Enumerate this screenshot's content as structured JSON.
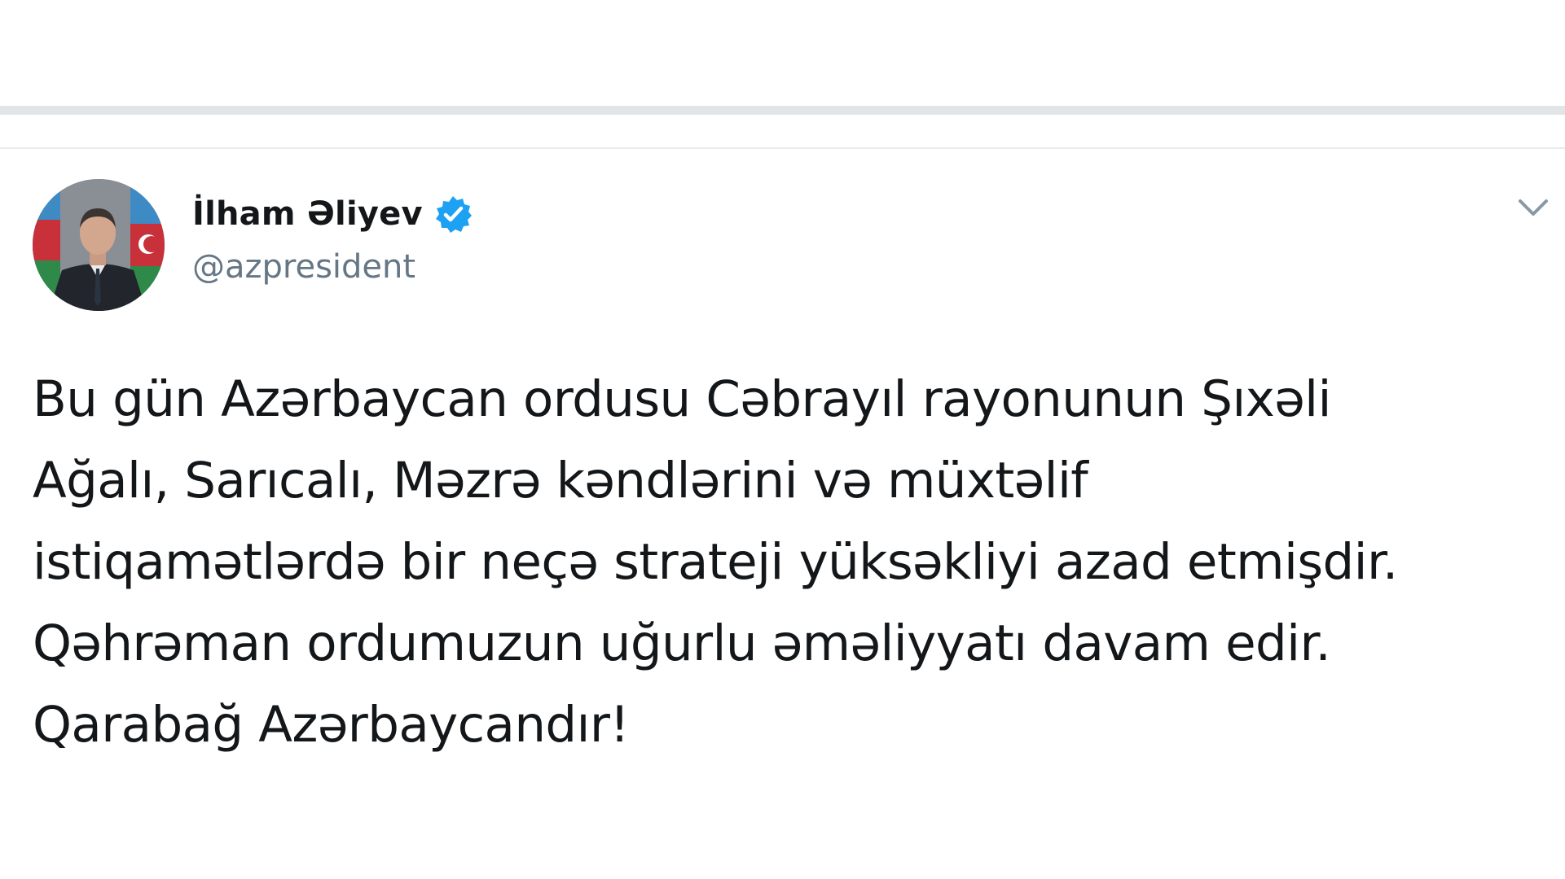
{
  "tweet": {
    "author": {
      "display_name": "İlham Əliyev",
      "handle": "@azpresident",
      "verified": true
    },
    "text_lines": [
      "Bu gün Azərbaycan ordusu Cəbrayıl rayonunun Şıxəli",
      "Ağalı, Sarıcalı, Məzrə kəndlərini və müxtəlif",
      "istiqamətlərdə bir neçə strateji yüksəkliyi azad etmişdir.",
      "Qəhrəman ordumuzun uğurlu əməliyyatı davam edir.",
      "Qarabağ Azərbaycandır!"
    ]
  },
  "icons": {
    "verified": "verified-badge-icon",
    "menu": "chevron-down-icon"
  },
  "colors": {
    "verified_badge": "#1da1f2",
    "text_primary": "#14171a",
    "text_secondary": "#657786"
  }
}
